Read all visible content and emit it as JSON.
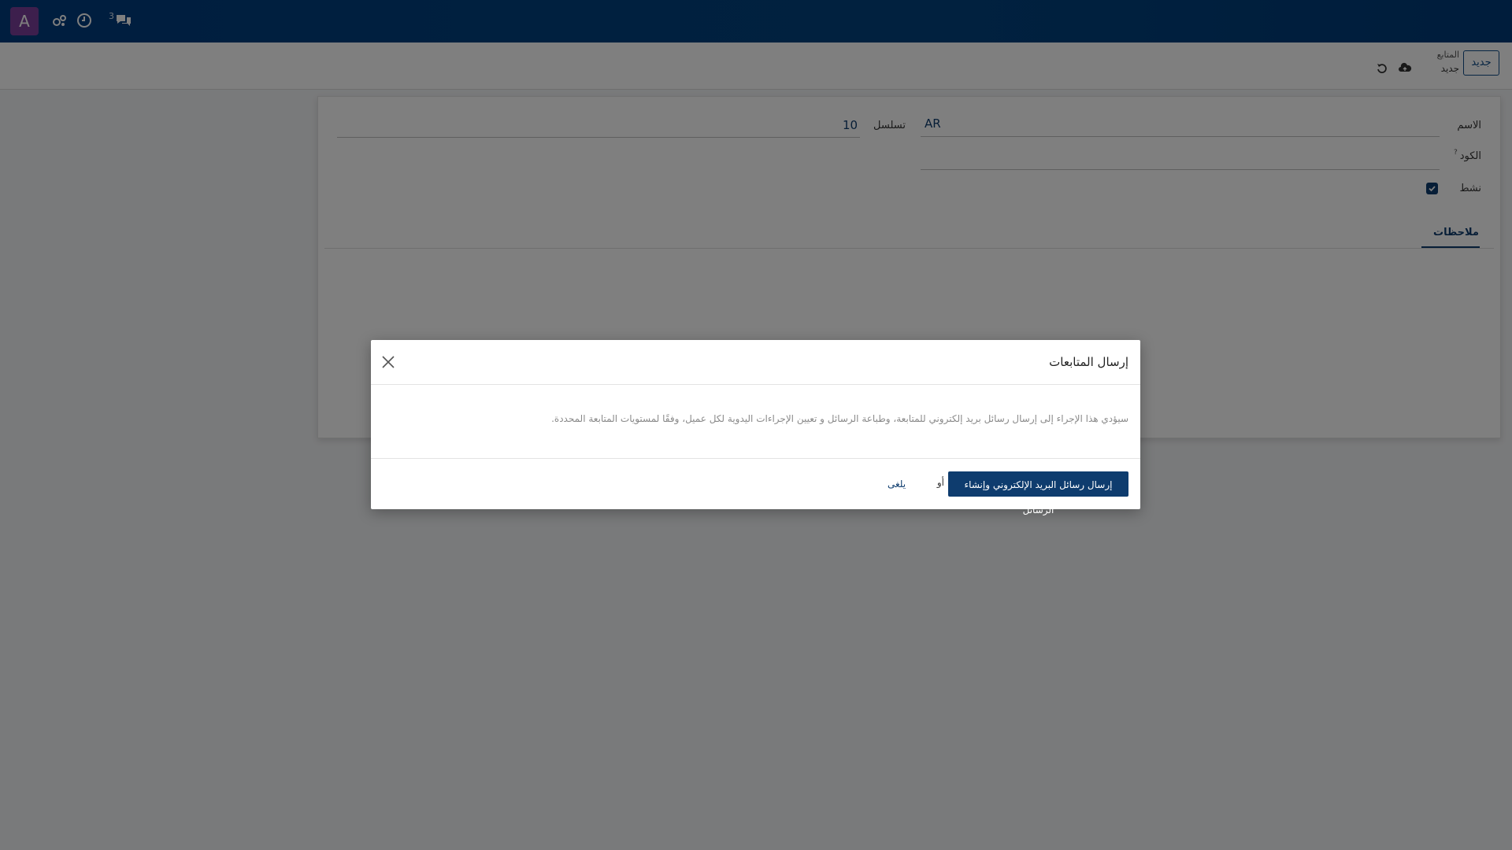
{
  "navbar": {
    "avatar_letter": "A",
    "icons": [
      "activity-icon",
      "clock-icon",
      "chat-icon"
    ],
    "chat_count": "3"
  },
  "control_panel": {
    "breadcrumb_parent": "المتابع",
    "breadcrumb_current": "جديد",
    "new_button": "جديد"
  },
  "form": {
    "name_label": "الاسم",
    "name_value": "AR",
    "sequence_label": "تسلسل",
    "sequence_value": "10",
    "code_label": "الكود",
    "code_help": "?",
    "active_label": "نشط",
    "active_checked": true,
    "tab_notes": "ملاحظات"
  },
  "modal": {
    "title": "إرسال المتابعات",
    "body_text": "سيؤدي هذا الإجراء إلى إرسال رسائل بريد إلكتروني للمتابعة، وطباعة الرسائل و تعيين الإجراءات اليدوية لكل عميل، وفقًا لمستويات المتابعة المحددة.",
    "primary_button": "إرسال رسائل البريد الإلكتروني وإنشاء الرسائل",
    "or_text": "أو",
    "discard_link": "يلغى"
  },
  "colors": {
    "brand": "#0e3c6e",
    "navbar": "#003c7e",
    "avatar": "#7a3f9a"
  }
}
